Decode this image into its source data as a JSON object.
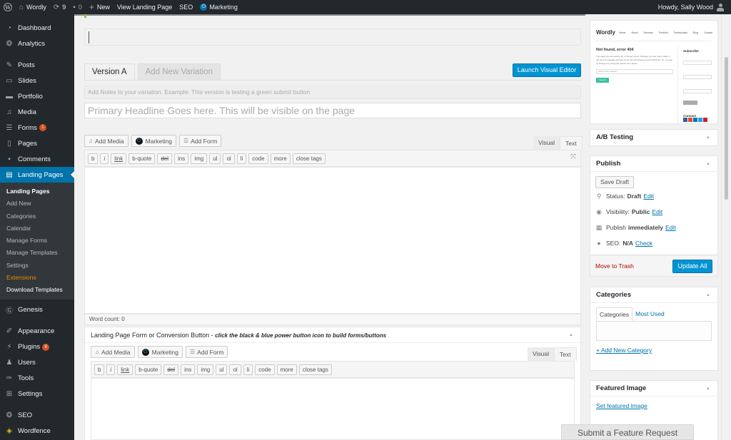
{
  "adminbar": {
    "site_name": "Wordly",
    "updates_count": "9",
    "comments_count": "0",
    "new_label": "New",
    "view_label": "View Landing Page",
    "seo_label": "SEO",
    "marketing_label": "Marketing",
    "howdy": "Howdy, Sally Wood"
  },
  "sidebar": {
    "items": [
      {
        "label": "Dashboard",
        "icon": "dashboard-icon"
      },
      {
        "label": "Analytics",
        "icon": "analytics-icon"
      },
      {
        "label": "Posts",
        "icon": "pin-icon"
      },
      {
        "label": "Slides",
        "icon": "slides-icon"
      },
      {
        "label": "Portfolio",
        "icon": "folder-icon"
      },
      {
        "label": "Media",
        "icon": "media-icon"
      },
      {
        "label": "Forms",
        "icon": "forms-icon",
        "badge": "1"
      },
      {
        "label": "Pages",
        "icon": "pages-icon"
      },
      {
        "label": "Comments",
        "icon": "comment-icon"
      },
      {
        "label": "Landing Pages",
        "icon": "page-icon"
      }
    ],
    "submenu": [
      "Landing Pages",
      "Add New",
      "Categories",
      "Calendar",
      "Manage Forms",
      "Manage Templates",
      "Settings",
      "Extensions",
      "Download Templates"
    ],
    "items2": [
      {
        "label": "Genesis",
        "icon": "genesis-icon"
      },
      {
        "label": "Appearance",
        "icon": "brush-icon"
      },
      {
        "label": "Plugins",
        "icon": "plugin-icon",
        "badge": "8"
      },
      {
        "label": "Users",
        "icon": "user-icon"
      },
      {
        "label": "Tools",
        "icon": "wrench-icon"
      },
      {
        "label": "Settings",
        "icon": "settings-icon"
      },
      {
        "label": "SEO",
        "icon": "seo-icon"
      },
      {
        "label": "Wordfence",
        "icon": "shield-icon"
      }
    ]
  },
  "main": {
    "tabs": [
      "Version A",
      "Add New Variation"
    ],
    "launch_label": "Launch Visual Editor",
    "notes_placeholder": "Add Notes to your variation. Example: This version is testing a green submit button",
    "headline_placeholder": "Primary Headline Goes here. This will be visible on the page",
    "media_buttons": [
      "Add Media",
      "Marketing",
      "Add Form"
    ],
    "editor_tabs": [
      "Visual",
      "Text"
    ],
    "quicktags": [
      "b",
      "i",
      "link",
      "b-quote",
      "del",
      "ins",
      "img",
      "ul",
      "ol",
      "li",
      "code",
      "more",
      "close tags"
    ],
    "word_count": "Word count: 0",
    "lp_box_title": "Landing Page Form or Conversion Button - ",
    "lp_box_hint": "click the black & blue power button icon to build forms/buttons"
  },
  "preview": {
    "logo": "Wordly",
    "nav": [
      "Home",
      "About",
      "Services",
      "Portfolio",
      "Testimonials",
      "Blog",
      "Contact"
    ],
    "title": "Not found, error 404",
    "para": "The page you are looking for no longer exists. Perhaps you can return back to the site's homepage and see if you can find what you are looking for. Or, you can try finding it by using the search form below.",
    "search_placeholder": "Search this website...",
    "search_btn": "Search",
    "subscribe": "Subscribe",
    "connect": "Connect"
  },
  "right": {
    "ab_title": "A/B Testing",
    "publish_title": "Publish",
    "save_draft": "Save Draft",
    "status_label": "Status:",
    "status_value": "Draft",
    "visibility_label": "Visibility:",
    "visibility_value": "Public",
    "publish_label": "Publish",
    "publish_value": "immediately",
    "seo_label": "SEO:",
    "seo_value": "N/A",
    "edit": "Edit",
    "check": "Check",
    "trash": "Move to Trash",
    "update": "Update All",
    "categories_title": "Categories",
    "cat_tabs": [
      "Categories",
      "Most Used"
    ],
    "add_category": "+ Add New Category",
    "featured_title": "Featured Image",
    "set_featured": "Set featured image"
  },
  "feature_request": "Submit a Feature Request",
  "colors": {
    "accent": "#0073aa",
    "button": "#0094d1",
    "adminbar": "#23282d",
    "badge": "#d54e21",
    "extensions": "#f18500",
    "trash": "#a00000"
  }
}
